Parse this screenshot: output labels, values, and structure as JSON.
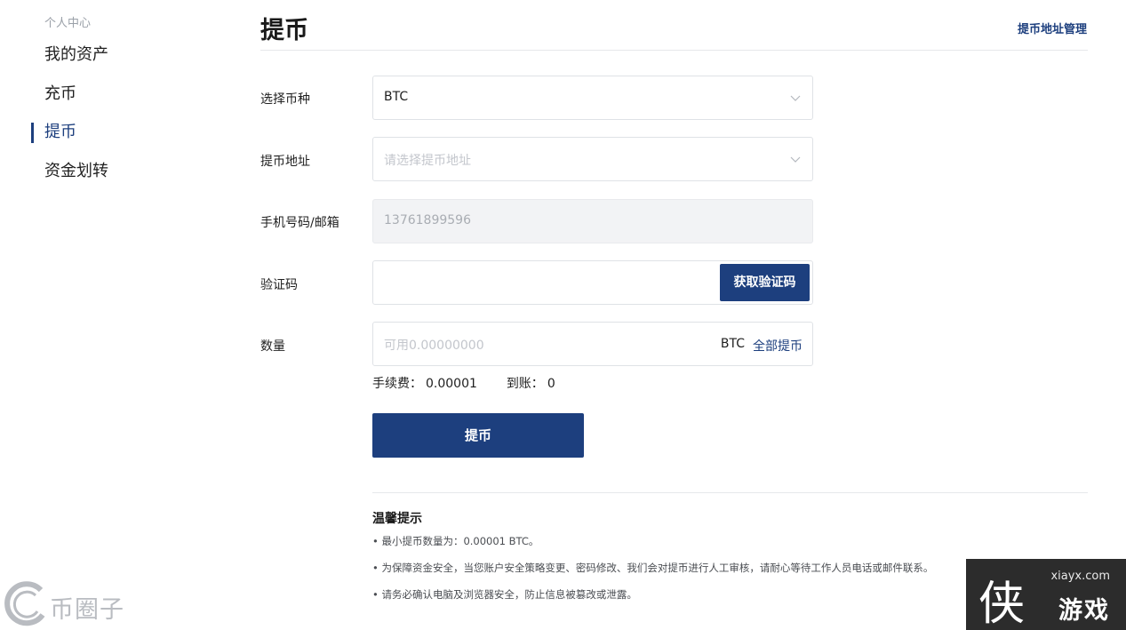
{
  "sidebar": {
    "section_title": "个人中心",
    "items": [
      {
        "label": "我的资产"
      },
      {
        "label": "充币"
      },
      {
        "label": "提币"
      },
      {
        "label": "资金划转"
      }
    ],
    "active_index": 2
  },
  "header": {
    "title": "提币",
    "address_manage_link": "提币地址管理"
  },
  "form": {
    "currency": {
      "label": "选择币种",
      "value": "BTC"
    },
    "address": {
      "label": "提币地址",
      "placeholder": "请选择提币地址"
    },
    "account": {
      "label": "手机号码/邮箱",
      "value": "13761899596"
    },
    "code": {
      "label": "验证码",
      "button": "获取验证码"
    },
    "amount": {
      "label": "数量",
      "placeholder": "可用0.00000000",
      "unit": "BTC",
      "all_link": "全部提币"
    },
    "fee": {
      "label": "手续费：",
      "value": "0.00001"
    },
    "received": {
      "label": "到账：",
      "value": "0"
    },
    "submit": "提币"
  },
  "tips": {
    "title": "温馨提示",
    "items": [
      "• 最小提币数量为：0.00001 BTC。",
      "• 为保障资金安全，当您账户安全策略变更、密码修改、我们会对提币进行人工审核，请耐心等待工作人员电话或邮件联系。",
      "• 请务必确认电脑及浏览器安全，防止信息被篡改或泄露。"
    ]
  },
  "watermarks": {
    "left_text": "币圈子",
    "right_domain": "xiayx.com",
    "right_glyph": "侠",
    "right_brand": "游戏"
  },
  "colors": {
    "accent": "#1d3f7e",
    "divider": "#e6e8eb",
    "disabled_bg": "#f2f3f5"
  }
}
